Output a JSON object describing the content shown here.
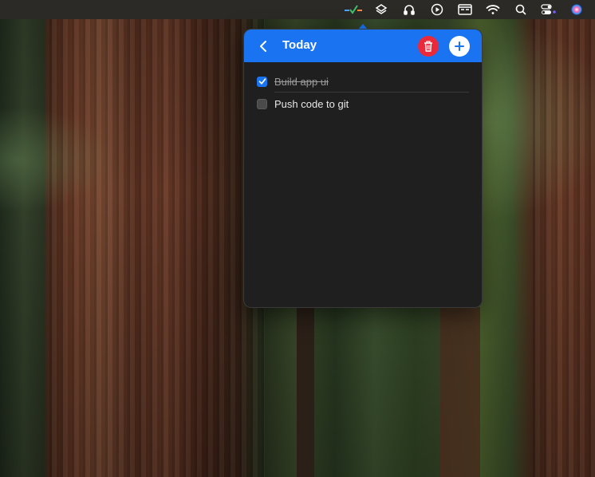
{
  "menubar": {
    "items": [
      {
        "icon": "checklist-app-icon"
      },
      {
        "icon": "layers-icon"
      },
      {
        "icon": "headphones-icon"
      },
      {
        "icon": "play-circle-icon"
      },
      {
        "icon": "display-icon"
      },
      {
        "icon": "wifi-icon"
      },
      {
        "icon": "search-icon"
      },
      {
        "icon": "control-center-icon"
      },
      {
        "icon": "siri-icon"
      }
    ]
  },
  "popover": {
    "title": "Today",
    "header_color": "#1a73f0",
    "delete_color": "#ea2a3a",
    "tasks": [
      {
        "label": "Build app ui",
        "done": true
      },
      {
        "label": "Push code to git",
        "done": false
      }
    ]
  }
}
